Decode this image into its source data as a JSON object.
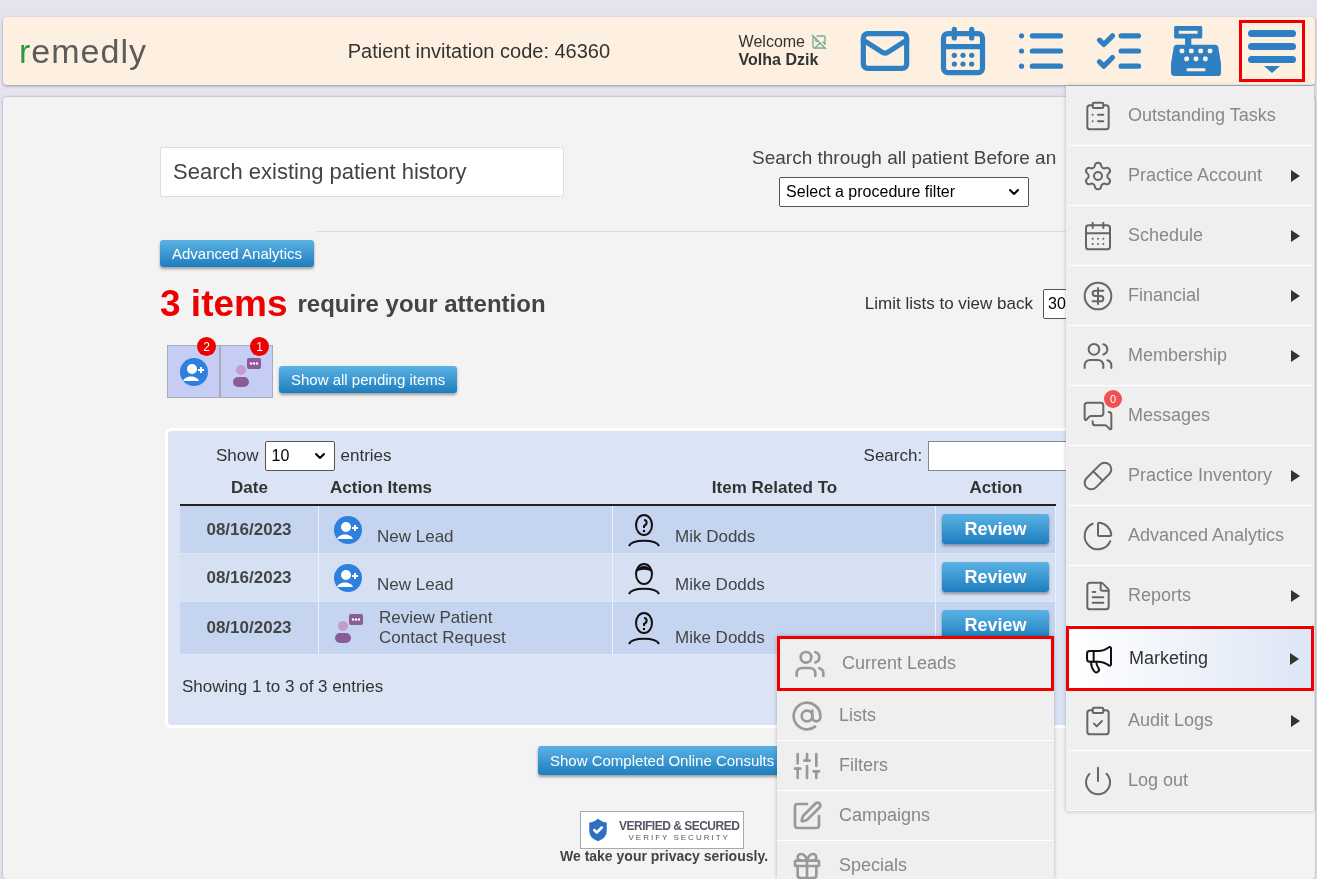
{
  "header": {
    "logo": "remedly",
    "invitation": "Patient invitation code: 46360",
    "welcome": "Welcome",
    "user": "Volha Dzik",
    "icons": [
      {
        "kind": "mail",
        "selected": false
      },
      {
        "kind": "calendar",
        "selected": false
      },
      {
        "kind": "list",
        "selected": false
      },
      {
        "kind": "checklist",
        "selected": false
      },
      {
        "kind": "register",
        "selected": false
      },
      {
        "kind": "menu",
        "selected": true
      }
    ]
  },
  "search": {
    "placeholder": "Search existing patient history"
  },
  "before_after": {
    "label": "Search through all patient Before an",
    "filter": "Select a procedure filter"
  },
  "analytics_button": "Advanced Analytics",
  "attention": {
    "count": "3 items",
    "text": "require your attention"
  },
  "limit": {
    "label": "Limit lists to view back",
    "value": "30"
  },
  "pending_tiles": [
    {
      "kind": "lead",
      "badge": "2"
    },
    {
      "kind": "contact",
      "badge": "1"
    }
  ],
  "pending_button": "Show all pending items",
  "table": {
    "show": "Show",
    "entries_value": "10",
    "entries": "entries",
    "search_label": "Search:",
    "columns": [
      "Date",
      "Action Items",
      "Item Related To",
      "Action"
    ],
    "rows": [
      {
        "date": "08/16/2023",
        "action": {
          "kind": "lead",
          "text": "New Lead"
        },
        "related": {
          "kind": "unknown",
          "name": "Mik Dodds"
        },
        "button": "Review"
      },
      {
        "date": "08/16/2023",
        "action": {
          "kind": "lead",
          "text": "New Lead"
        },
        "related": {
          "kind": "person",
          "name": "Mike Dodds"
        },
        "button": "Review"
      },
      {
        "date": "08/10/2023",
        "action": {
          "kind": "contact",
          "text": "Review Patient Contact Request"
        },
        "related": {
          "kind": "unknown",
          "name": "Mike Dodds"
        },
        "button": "Review"
      }
    ],
    "footer": "Showing 1 to 3 of 3 entries"
  },
  "consults_button": "Show Completed Online Consults",
  "seal": {
    "title": "VERIFIED & SECURED",
    "subtitle": "VERIFY SECURITY"
  },
  "privacy": "We take your privacy seriously.",
  "menu": {
    "items": [
      {
        "label": "Outstanding Tasks",
        "submenu": false,
        "selected": false
      },
      {
        "label": "Practice Account",
        "submenu": true,
        "selected": false
      },
      {
        "label": "Schedule",
        "submenu": true,
        "selected": false
      },
      {
        "label": "Financial",
        "submenu": true,
        "selected": false
      },
      {
        "label": "Membership",
        "submenu": true,
        "selected": false
      },
      {
        "label": "Messages",
        "submenu": false,
        "selected": false,
        "badge": "0"
      },
      {
        "label": "Practice Inventory",
        "submenu": true,
        "selected": false
      },
      {
        "label": "Advanced Analytics",
        "submenu": false,
        "selected": false
      },
      {
        "label": "Reports",
        "submenu": true,
        "selected": false
      },
      {
        "label": "Marketing",
        "submenu": true,
        "selected": true
      },
      {
        "label": "Audit Logs",
        "submenu": true,
        "selected": false
      },
      {
        "label": "Log out",
        "submenu": false,
        "selected": false
      }
    ]
  },
  "submenu": {
    "items": [
      {
        "label": "Current Leads",
        "selected": true
      },
      {
        "label": "Lists",
        "selected": false
      },
      {
        "label": "Filters",
        "selected": false
      },
      {
        "label": "Campaigns",
        "selected": false
      },
      {
        "label": "Specials",
        "selected": false
      }
    ]
  }
}
